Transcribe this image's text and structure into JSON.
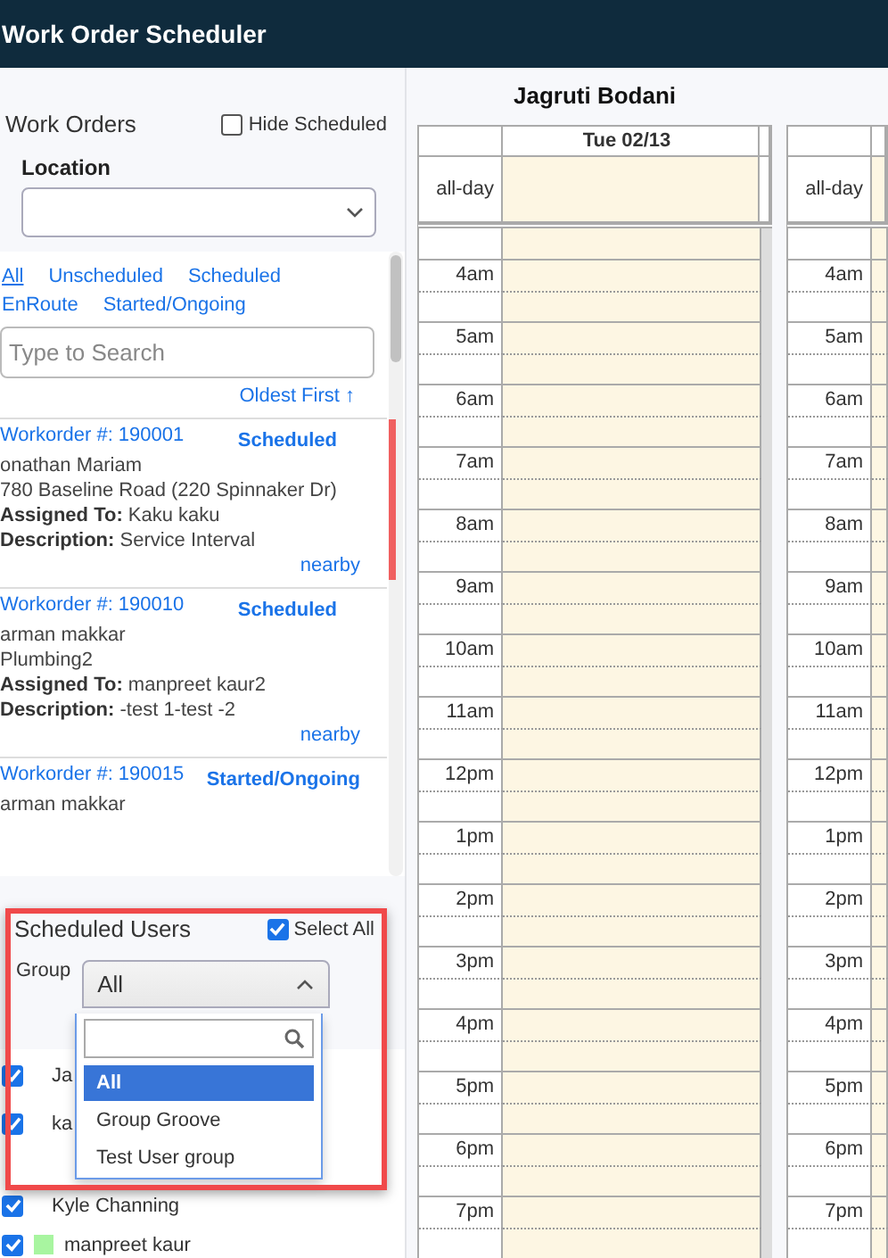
{
  "window": {
    "title": "Work Order Scheduler"
  },
  "work_orders": {
    "title": "Work Orders",
    "hide_scheduled": {
      "label": "Hide Scheduled",
      "checked": false
    },
    "location": {
      "label": "Location"
    },
    "filters": [
      {
        "label": "All",
        "selected": true
      },
      {
        "label": "Unscheduled",
        "selected": false
      },
      {
        "label": "Scheduled",
        "selected": false
      },
      {
        "label": "EnRoute",
        "selected": false
      },
      {
        "label": "Started/Ongoing",
        "selected": false
      }
    ],
    "search": {
      "placeholder": "Type to Search"
    },
    "sort": {
      "label": "Oldest First ↑"
    },
    "orders": [
      {
        "number": "Workorder #: 190001",
        "status": "Scheduled",
        "flagged": true,
        "lines": [
          "onathan Mariam",
          "780 Baseline Road (220 Spinnaker Dr)",
          "**Assigned To:** Kaku kaku",
          "**Description:** Service Interval"
        ],
        "link": "nearby"
      },
      {
        "number": "Workorder #: 190010",
        "status": "Scheduled",
        "flagged": false,
        "lines": [
          "arman makkar",
          "Plumbing2",
          "**Assigned To:** manpreet kaur2",
          "**Description:** -test 1-test -2"
        ],
        "link": "nearby"
      },
      {
        "number": "Workorder #: 190015",
        "status": "Started/Ongoing",
        "flagged": false,
        "lines": [
          "arman makkar"
        ]
      }
    ]
  },
  "scheduled_users": {
    "title": "Scheduled Users",
    "select_all": {
      "label": "Select All",
      "checked": true
    },
    "group": {
      "label": "Group",
      "value": "All",
      "expanded": true,
      "options": [
        {
          "label": "All",
          "selected": true
        },
        {
          "label": "Group Groove",
          "selected": false
        },
        {
          "label": "Test User group",
          "selected": false
        }
      ]
    },
    "users": [
      {
        "name": "Ja",
        "checked": true
      },
      {
        "name": "ka",
        "checked": true
      },
      {
        "name": "Kyle Channing",
        "checked": true
      },
      {
        "name": "manpreet kaur",
        "checked": true,
        "color": "#a8f5a0"
      }
    ]
  },
  "calendar": {
    "resources": [
      {
        "name": "Jagruti Bodani",
        "date": "Tue 02/13",
        "all_day": "all-day",
        "times": [
          "4am",
          "5am",
          "6am",
          "7am",
          "8am",
          "9am",
          "10am",
          "11am",
          "12pm",
          "1pm",
          "2pm",
          "3pm",
          "4pm",
          "5pm",
          "6pm",
          "7pm"
        ]
      },
      {
        "all_day": "all-day",
        "times": [
          "4am",
          "5am",
          "6am",
          "7am",
          "8am",
          "9am",
          "10am",
          "11am",
          "12pm",
          "1pm",
          "2pm",
          "3pm",
          "4pm",
          "5pm",
          "6pm",
          "7pm"
        ]
      }
    ]
  }
}
